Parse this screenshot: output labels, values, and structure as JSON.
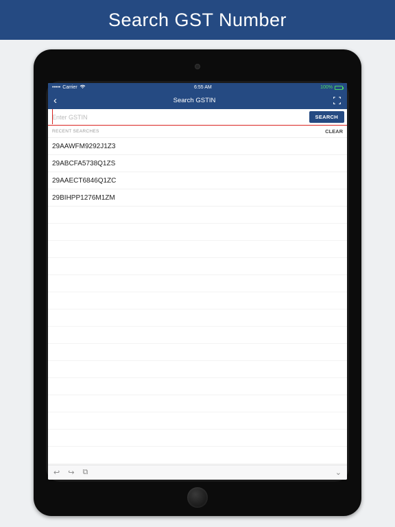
{
  "promo": {
    "headline": "Search GST Number"
  },
  "statusbar": {
    "carrier": "Carrier",
    "time": "6:55 AM",
    "battery": "100%"
  },
  "navbar": {
    "title": "Search GSTIN"
  },
  "search": {
    "placeholder": "Enter GSTIN",
    "button": "SEARCH"
  },
  "recent": {
    "label": "RECENT SEARCHES",
    "clear": "CLEAR"
  },
  "items": [
    "29AAWFM9292J1Z3",
    "29ABCFA5738Q1ZS",
    "29AAECT6846Q1ZC",
    "29BIHPP1276M1ZM"
  ]
}
